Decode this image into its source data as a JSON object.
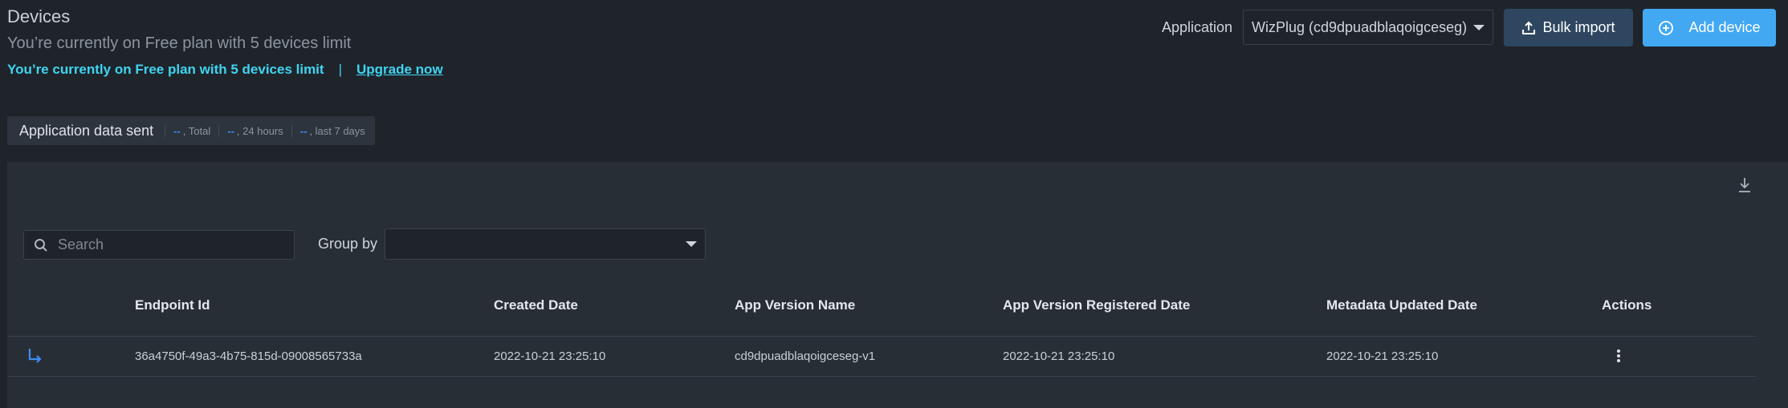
{
  "header": {
    "title": "Devices",
    "plan_text": "You’re currently on Free plan with 5 devices limit",
    "plan_alert": "You’re currently on Free plan with 5 devices limit",
    "plan_separator": "|",
    "upgrade_link": "Upgrade now"
  },
  "toolbar": {
    "application_label": "Application",
    "application_value": "WizPlug (cd9dpuadblaqoigceseg)",
    "bulk_import_label": "Bulk import",
    "add_device_label": "Add device"
  },
  "data_sent": {
    "label": "Application data sent",
    "stats": [
      {
        "value": "--",
        "suffix": ", Total"
      },
      {
        "value": "--",
        "suffix": ", 24 hours"
      },
      {
        "value": "--",
        "suffix": ", last 7 days"
      }
    ]
  },
  "filters": {
    "search_placeholder": "Search",
    "search_value": "",
    "group_by_label": "Group by",
    "group_by_value": ""
  },
  "table": {
    "columns": [
      "Endpoint Id",
      "Created Date",
      "App Version Name",
      "App Version Registered Date",
      "Metadata Updated Date",
      "Actions"
    ],
    "rows": [
      {
        "endpoint_id": "36a4750f-49a3-4b75-815d-09008565733a",
        "created": "2022-10-21 23:25:10",
        "app_version_name": "cd9dpuadblaqoigceseg-v1",
        "app_version_registered": "2022-10-21 23:25:10",
        "metadata_updated": "2022-10-21 23:25:10"
      }
    ]
  },
  "colors": {
    "accent_cyan": "#3fd4f0",
    "primary_blue": "#42a8f2",
    "secondary_button": "#2e4660",
    "background": "#1f242b",
    "panel": "#282e35"
  }
}
